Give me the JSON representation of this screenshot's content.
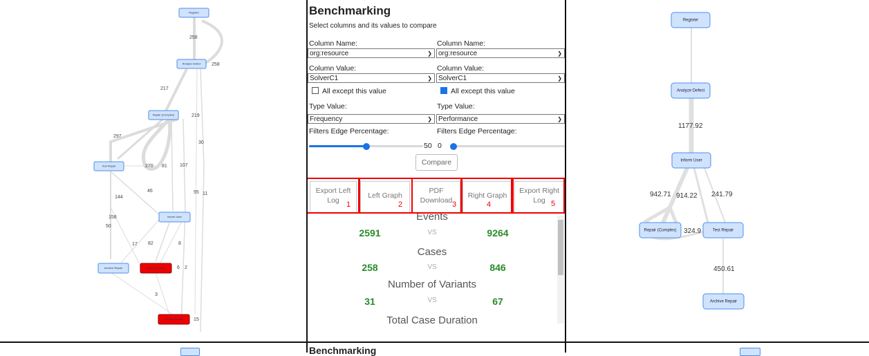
{
  "left_graph": {
    "nodes": [
      {
        "id": "register",
        "label": "Register"
      },
      {
        "id": "analyze",
        "label": "Analyze Defect"
      },
      {
        "id": "repair_complex",
        "label": "Repair (Complex)"
      },
      {
        "id": "test_repair",
        "label": "Test Repair"
      },
      {
        "id": "inform_user",
        "label": "Inform User"
      },
      {
        "id": "archive",
        "label": "Archive Repair"
      },
      {
        "id": "repair_simple",
        "label": "Repair (Simple)"
      },
      {
        "id": "end",
        "label": "Restart Repair"
      }
    ],
    "edge_labels": [
      "258",
      "258",
      "217",
      "219",
      "30",
      "297",
      "270",
      "81",
      "107",
      "46",
      "55",
      "11",
      "144",
      "158",
      "50",
      "17",
      "82",
      "8",
      "6",
      "2",
      "3",
      "15"
    ],
    "highlight_color": "#ee0000",
    "node_color": "#cfe3ff"
  },
  "middle": {
    "title": "Benchmarking",
    "subtitle": "Select columns and its values to compare",
    "left": {
      "column_name_label": "Column Name:",
      "column_name_value": "org:resource",
      "column_value_label": "Column Value:",
      "column_value_value": "SolverC1",
      "except_label": "All except this value",
      "except_checked": false,
      "type_label": "Type Value:",
      "type_value": "Frequency",
      "filters_label": "Filters Edge Percentage:",
      "slider_value": "50",
      "slider_fraction": 0.5
    },
    "right": {
      "column_name_label": "Column Name:",
      "column_name_value": "org:resource",
      "column_value_label": "Column Value:",
      "column_value_value": "SolverC1",
      "except_label": "All except this value",
      "except_checked": true,
      "type_label": "Type Value:",
      "type_value": "Performance",
      "filters_label": "Filters Edge Percentage:",
      "slider_value": "0",
      "slider_fraction": 0.0
    },
    "compare_label": "Compare",
    "export_buttons": [
      {
        "line1": "Export Left",
        "line2": "Log",
        "num": "1"
      },
      {
        "line1": "Left Graph",
        "line2": "",
        "num": "2"
      },
      {
        "line1": "PDF",
        "line2": "Download",
        "num": "3"
      },
      {
        "line1": "Right Graph",
        "line2": "",
        "num": "4"
      },
      {
        "line1": "Export Right",
        "line2": "Log",
        "num": "5"
      }
    ],
    "stats": [
      {
        "heading": "Events",
        "left": "2591",
        "vs": "VS",
        "right": "9264"
      },
      {
        "heading": "Cases",
        "left": "258",
        "vs": "VS",
        "right": "846"
      },
      {
        "heading": "Number of Variants",
        "left": "31",
        "vs": "VS",
        "right": "67"
      },
      {
        "heading": "Total Case Duration"
      }
    ],
    "peek_title": "Benchmarking"
  },
  "right_graph": {
    "nodes": [
      {
        "id": "register",
        "label": "Register"
      },
      {
        "id": "analyze",
        "label": "Analyze Defect"
      },
      {
        "id": "inform",
        "label": "Inform User"
      },
      {
        "id": "repair_complex",
        "label": "Repair (Complex)"
      },
      {
        "id": "test_repair",
        "label": "Test Repair"
      },
      {
        "id": "archive",
        "label": "Archive Repair"
      }
    ],
    "edge_labels": [
      "1177.92",
      "942.71",
      "914.22",
      "241.79",
      "324.9",
      "450.61"
    ]
  },
  "colors": {
    "accent": "#1a73e8",
    "stat_green": "#2a8a2a",
    "highlight": "#e00000"
  }
}
